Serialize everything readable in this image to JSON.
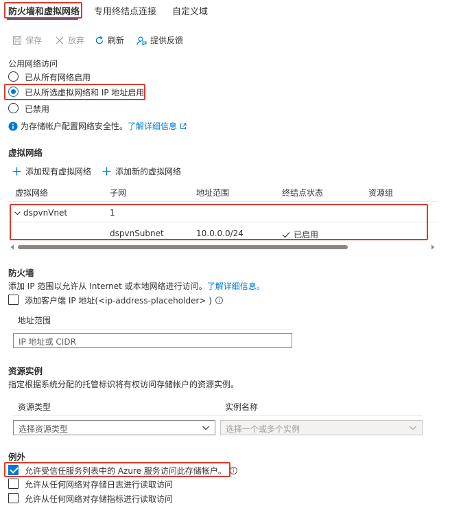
{
  "tabs": [
    {
      "label": "防火墙和虚拟网络"
    },
    {
      "label": "专用终结点连接"
    },
    {
      "label": "自定义域"
    }
  ],
  "toolbar": {
    "save_label": "保存",
    "discard_label": "放弃",
    "refresh_label": "刷新",
    "feedback_label": "提供反馈"
  },
  "public_access": {
    "title": "公用网络访问",
    "options": [
      {
        "label": "已从所有网络启用",
        "checked": false
      },
      {
        "label": "已从所选虚拟网络和 IP 地址启用",
        "checked": true
      },
      {
        "label": "已禁用",
        "checked": false
      }
    ],
    "info_text": "为存储帐户配置网络安全性。",
    "info_link": "了解详细信息"
  },
  "vnet": {
    "title": "虚拟网络",
    "add_existing_label": "添加现有虚拟网络",
    "add_new_label": "添加新的虚拟网络",
    "columns": [
      "虚拟网络",
      "子网",
      "地址范围",
      "终结点状态",
      "资源组"
    ],
    "rows": [
      {
        "name": "dspvnVnet",
        "subnet": "1",
        "range": "",
        "status": "",
        "group": ""
      },
      {
        "name": "",
        "subnet": "dspvnSubnet",
        "range": "10.0.0.0/24",
        "status": "已启用",
        "group": ""
      }
    ]
  },
  "firewall": {
    "title": "防火墙",
    "description": "添加 IP 范围以允许从 Internet 或本地网络进行访问。",
    "description_link": "了解详细信息。",
    "add_client_ip_label": "添加客户端 IP 地址(<ip-address-placeholder> )",
    "address_range_header": "地址范围",
    "address_input_placeholder": "IP 地址或 CIDR"
  },
  "resource_instances": {
    "title": "资源实例",
    "description": "指定根据系统分配的托管标识将有权访问存储帐户的资源实例。",
    "resource_type_header": "资源类型",
    "instance_name_header": "实例名称",
    "resource_type_placeholder": "选择资源类型",
    "instance_placeholder": "选择一个或多个实例"
  },
  "exceptions": {
    "title": "例外",
    "items": [
      {
        "label": "允许受信任服务列表中的 Azure 服务访问此存储帐户。",
        "checked": true
      },
      {
        "label": "允许从任何网络对存储日志进行读取访问",
        "checked": false
      },
      {
        "label": "允许从任何网络对存储指标进行读取访问",
        "checked": false
      }
    ]
  },
  "colors": {
    "accent": "#0078d4",
    "highlight": "#e0392b"
  }
}
